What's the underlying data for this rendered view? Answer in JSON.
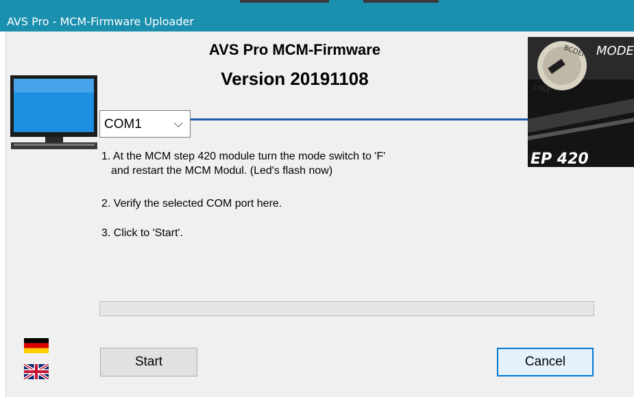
{
  "window": {
    "title": "AVS Pro  -  MCM-Firmware Uploader",
    "heading": "AVS Pro  MCM-Firmware",
    "version": "Version 20191108"
  },
  "port_select": {
    "value": "COM1",
    "icon": "chevron-down-icon"
  },
  "instructions": {
    "step1_line1": "1. At the MCM step 420 module turn the mode switch to 'F'",
    "step1_line2": "and restart the MCM Modul. (Led's flash now)",
    "step2": "2. Verify the selected COM port here.",
    "step3": "3. Click to 'Start'."
  },
  "progress": {
    "value": 0
  },
  "buttons": {
    "start": "Start",
    "cancel": "Cancel"
  },
  "photo": {
    "dial_text": "BCDEF0123",
    "dial_text2": "4567",
    "corner_label": "MODE",
    "model_label": "EP 420"
  },
  "languages": [
    {
      "name": "german-flag-icon"
    },
    {
      "name": "uk-flag-icon"
    }
  ],
  "colors": {
    "titlebar": "#1a8fae",
    "link_line": "#1b5ea8",
    "cancel_border": "#0078d7"
  }
}
